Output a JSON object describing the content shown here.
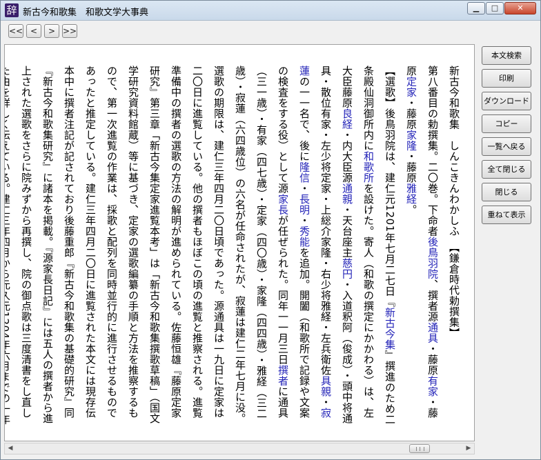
{
  "window": {
    "icon_glyph": "辞",
    "title": "新古今和歌集　和歌文学大事典",
    "controls": {
      "minimize": "▁",
      "maximize": "□",
      "close": "✕"
    }
  },
  "nav": {
    "first": "<<",
    "prev": "<",
    "next": ">",
    "last": ">>"
  },
  "side_buttons": [
    "本文検索",
    "印刷",
    "ダウンロード",
    "コピー",
    "一覧へ戻る",
    "全て閉じる",
    "閉じる",
    "重ねて表示"
  ],
  "entry": {
    "headword": "新古今和歌集",
    "reading": "しんこきんわかしふ",
    "era": "【鎌倉時代勅撰集】",
    "p1": [
      {
        "t": "第八番目の勅撰集。二〇巻。下命者"
      },
      {
        "t": "後鳥羽院",
        "link": true
      },
      {
        "t": "、撰者源"
      },
      {
        "t": "通具",
        "link": true
      },
      {
        "t": "・藤原"
      },
      {
        "t": "有家",
        "link": true
      },
      {
        "t": "・藤原"
      },
      {
        "t": "定家",
        "link": true
      },
      {
        "t": "・藤原"
      },
      {
        "t": "家隆",
        "link": true
      },
      {
        "t": "・藤原"
      },
      {
        "t": "雅経",
        "link": true
      },
      {
        "t": "。"
      }
    ],
    "p2": [
      {
        "t": "【選歌】後鳥羽院は、建仁元1201年七月二七日『"
      },
      {
        "t": "新古今集",
        "link": true
      },
      {
        "t": "』撰進のため二条殿仙洞御所内に"
      },
      {
        "t": "和歌所",
        "link": true
      },
      {
        "t": "を設けた。寄人（和歌の撰定にかかわる）は、左大臣藤原"
      },
      {
        "t": "良経",
        "link": true
      },
      {
        "t": "・内大臣源"
      },
      {
        "t": "通親",
        "link": true
      },
      {
        "t": "・天台座主"
      },
      {
        "t": "慈円",
        "link": true
      },
      {
        "t": "・入道釈阿（俊成）・頭中将通具・散位有家・左少将定家・上総介家隆・右少将雅経・左兵衛佐"
      },
      {
        "t": "具親",
        "link": true
      },
      {
        "t": "・"
      },
      {
        "t": "寂蓮",
        "link": true
      },
      {
        "t": "の一一名で、後に"
      },
      {
        "t": "隆信",
        "link": true
      },
      {
        "t": "・"
      },
      {
        "t": "長明",
        "link": true
      },
      {
        "t": "・"
      },
      {
        "t": "秀能",
        "link": true
      },
      {
        "t": "を追加。開闔（和歌所で記録や文案の検査をする役）として源"
      },
      {
        "t": "家長",
        "link": true
      },
      {
        "t": "が任ぜられた。同年一一月三日"
      },
      {
        "t": "撰者",
        "link": true
      },
      {
        "t": "に通具（三一歳）・有家（四七歳）・定家（四〇歳）・家隆（四四歳）・雅経（三二歳）・寂蓮（六四歳位）の六名が任命されたが、寂蓮は建仁二年七月に没。選歌の期限は、建仁三年四月二〇日頃であった。源通具は一九日に定家は二〇日に進覧している。他の撰者もほぼこの頃の進覧と推察される。進覧準備中の撰者の選歌の方法の解明が進められている。佐藤恒雄『藤原定家研究』第三章「新古今集定家進覧本考」は「新古今和歌集撰歌草稿」（国文学研究資料館蔵）等に基づき、定家の選歌編纂の手順と方法を推察するもので、第一次進覧の作業は、採歌と配列を同時並行的に進行させるものであったと推定している。建仁三年四月二〇日に進覧された本文には現存伝本中に撰者注記が記されており後藤重郎『新古今和歌集の基礎的研究』同『新古今和歌集研究』に諸本を掲載。『源家長日記』には五人の撰者から進上された選歌をさらに院みずから再撰し、院の御点歌は三度清書をし直した由を詳しく伝えている。建仁三年四月から元久元1204年六月までの一年半に及ぶ間を御点時"
      }
    ]
  },
  "scrollbar": {
    "left_arrow": "◀",
    "right_arrow": "▶",
    "position": 0.92
  }
}
